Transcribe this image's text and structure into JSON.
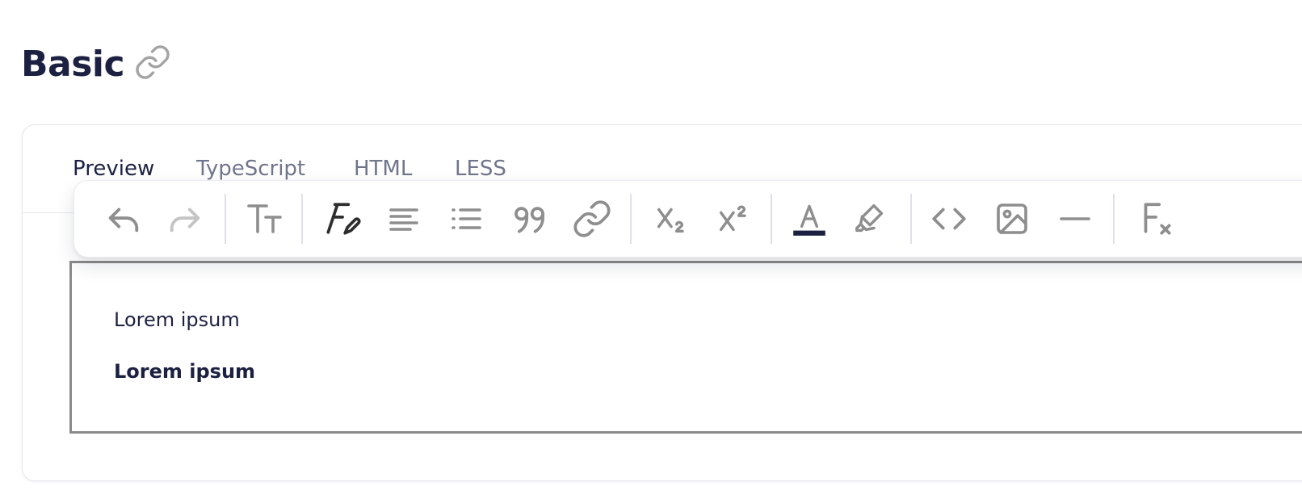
{
  "section": {
    "title": "Basic",
    "anchor_icon": "link-icon"
  },
  "tabs": [
    {
      "label": "Preview",
      "active": true
    },
    {
      "label": "TypeScript",
      "active": false
    },
    {
      "label": "HTML",
      "active": false
    },
    {
      "label": "LESS",
      "active": false
    }
  ],
  "toolbar": {
    "buttons": [
      {
        "name": "undo",
        "icon": "undo-icon",
        "enabled": true
      },
      {
        "name": "redo",
        "icon": "redo-icon",
        "enabled": false
      },
      {
        "name": "font-size",
        "icon": "font-size-icon",
        "enabled": true
      },
      {
        "name": "font-style",
        "icon": "font-style-icon",
        "enabled": true
      },
      {
        "name": "align",
        "icon": "align-left-icon",
        "enabled": true
      },
      {
        "name": "list",
        "icon": "bullet-list-icon",
        "enabled": true
      },
      {
        "name": "blockquote",
        "icon": "quote-icon",
        "enabled": true
      },
      {
        "name": "link",
        "icon": "link-icon",
        "enabled": true
      },
      {
        "name": "subscript",
        "icon": "subscript-icon",
        "enabled": true
      },
      {
        "name": "superscript",
        "icon": "superscript-icon",
        "enabled": true
      },
      {
        "name": "text-color",
        "icon": "text-color-icon",
        "enabled": true,
        "current_color": "#1c2142"
      },
      {
        "name": "highlight",
        "icon": "highlighter-icon",
        "enabled": true
      },
      {
        "name": "code",
        "icon": "code-icon",
        "enabled": true
      },
      {
        "name": "image",
        "icon": "image-icon",
        "enabled": true
      },
      {
        "name": "horizontal-rule",
        "icon": "horizontal-rule-icon",
        "enabled": true
      },
      {
        "name": "clear-formatting",
        "icon": "clear-formatting-icon",
        "enabled": true
      }
    ]
  },
  "editor": {
    "paragraphs": [
      {
        "text": "Lorem ipsum",
        "bold": false
      },
      {
        "text": "Lorem ipsum",
        "bold": true
      }
    ]
  },
  "colors": {
    "heading": "#1c2142",
    "icon": "#8e8e8e",
    "icon_disabled": "#c4c4c4",
    "icon_active": "#2e2e2e",
    "tab_inactive": "#70758c",
    "editor_border": "#8a8a8a"
  }
}
